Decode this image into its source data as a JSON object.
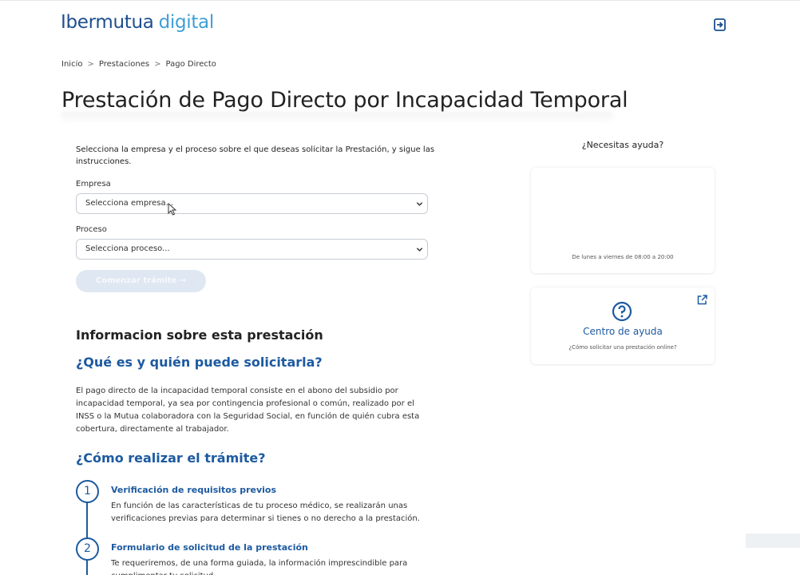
{
  "header": {
    "logo_text_main": "Ibermutua",
    "logo_text_accent": "digital",
    "logout_icon": "logout-icon"
  },
  "breadcrumb": {
    "items": [
      "Inicio",
      "Prestaciones",
      "Pago Directo"
    ],
    "separator": ">"
  },
  "page": {
    "title": "Prestación de Pago Directo por Incapacidad Temporal"
  },
  "form": {
    "intro": "Selecciona la empresa y el proceso sobre el que deseas solicitar la Prestación, y sigue las instrucciones.",
    "empresa_label": "Empresa",
    "empresa_value": "Selecciona empresa...",
    "proceso_label": "Proceso",
    "proceso_value": "Selecciona proceso...",
    "start_button": "Comenzar trámite →"
  },
  "info": {
    "heading": "Informacion sobre esta prestación",
    "q1": "¿Qué es y quién puede solicitarla?",
    "q1_text": "El pago directo de la incapacidad temporal consiste en el abono del subsidio por incapacidad temporal, ya sea por contingencia profesional o común, realizado por el INSS o la Mutua colaboradora con la Seguridad Social, en función de quién cubra esta cobertura, directamente al trabajador.",
    "q2": "¿Cómo realizar el trámite?",
    "steps": [
      {
        "number": "1",
        "title": "Verificación de requisitos previos",
        "text": "En función de las características de tu proceso médico, se realizarán unas verificaciones previas para determinar si tienes o no derecho a la prestación."
      },
      {
        "number": "2",
        "title": "Formulario de solicitud de la prestación",
        "text": "Te requeriremos, de una forma guiada, la información imprescindible para cumplimentar tu solicitud."
      }
    ]
  },
  "help": {
    "title": "¿Necesitas ayuda?",
    "hours": "De lunes a viernes de 08:00 a 20:00",
    "center_link": "Centro de ayuda",
    "center_sub": "¿Cómo solicitar una prestación online?",
    "colors": {
      "accent": "#1d5aa0",
      "brand": "#1d4f8f",
      "brand_light": "#3f9fd6"
    }
  }
}
